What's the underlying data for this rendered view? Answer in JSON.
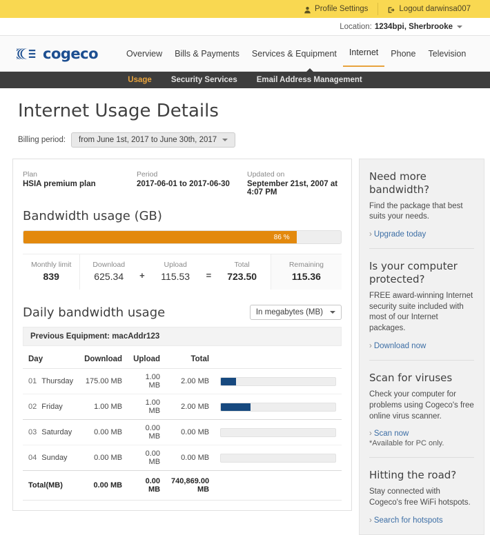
{
  "utilbar": {
    "profile_settings": "Profile Settings",
    "logout": "Logout darwinsa007"
  },
  "locationbar": {
    "label": "Location:",
    "value": "1234bpi, Sherbrooke"
  },
  "brand": {
    "name": "cogeco",
    "color": "#1d4f91"
  },
  "mainnav": {
    "items": [
      {
        "label": "Overview",
        "active": false
      },
      {
        "label": "Bills & Payments",
        "active": false
      },
      {
        "label": "Services & Equipment",
        "active": false
      },
      {
        "label": "Internet",
        "active": true
      },
      {
        "label": "Phone",
        "active": false
      },
      {
        "label": "Television",
        "active": false
      }
    ]
  },
  "subnav": {
    "items": [
      {
        "label": "Usage",
        "active": true
      },
      {
        "label": "Security Services",
        "active": false
      },
      {
        "label": "Email Address Management",
        "active": false
      }
    ]
  },
  "page": {
    "title": "Internet Usage Details",
    "billing_period_label": "Billing period:",
    "billing_period_value": "from June 1st, 2017 to June 30th, 2017"
  },
  "summary": {
    "plan_label": "Plan",
    "plan_value": "HSIA premium plan",
    "period_label": "Period",
    "period_value": "2017-06-01 to 2017-06-30",
    "updated_label": "Updated on",
    "updated_value": "September 21st, 2007 at 4:07 PM",
    "bandwidth_title": "Bandwidth usage (GB)",
    "progress_percent": 86,
    "progress_text": "86 %",
    "progress_color": "#e3890d",
    "stats": [
      {
        "label": "Monthly limit",
        "value": "839",
        "bold": true,
        "op": ""
      },
      {
        "label": "Download",
        "value": "625.34",
        "bold": false,
        "op": "+"
      },
      {
        "label": "Upload",
        "value": "115.53",
        "bold": false,
        "op": "="
      },
      {
        "label": "Total",
        "value": "723.50",
        "bold": true,
        "op": ""
      },
      {
        "label": "Remaining",
        "value": "115.36",
        "bold": true,
        "op": ""
      }
    ]
  },
  "daily": {
    "title": "Daily bandwidth usage",
    "unit_selected": "In megabytes (MB)",
    "equipment": "Previous Equipment: macAddr123",
    "columns": [
      "Day",
      "Download",
      "Upload",
      "Total"
    ],
    "rows": [
      {
        "num": "01",
        "day": "Thursday",
        "download": "175.00 MB",
        "upload": "1.00 MB",
        "total": "2.00 MB",
        "bar_percent": 13
      },
      {
        "num": "02",
        "day": "Friday",
        "download": "1.00 MB",
        "upload": "1.00 MB",
        "total": "2.00 MB",
        "bar_percent": 26
      },
      {
        "num": "03",
        "day": "Saturday",
        "download": "0.00 MB",
        "upload": "0.00 MB",
        "total": "0.00 MB",
        "bar_percent": 0
      },
      {
        "num": "04",
        "day": "Sunday",
        "download": "0.00 MB",
        "upload": "0.00 MB",
        "total": "0.00 MB",
        "bar_percent": 0
      }
    ],
    "total_row": {
      "label": "Total(MB)",
      "download": "0.00 MB",
      "upload": "0.00 MB",
      "total": "740,869.00 MB"
    },
    "bar_color": "#17497f"
  },
  "sidebar": {
    "promos": [
      {
        "title": "Need more bandwidth?",
        "body": "Find the package that best suits your needs.",
        "link": "Upgrade today",
        "note": ""
      },
      {
        "title": "Is your computer protected?",
        "body": "FREE award-winning Internet security suite included with most of our Internet packages.",
        "link": "Download now",
        "note": ""
      },
      {
        "title": "Scan for viruses",
        "body": "Check your computer for problems using Cogeco's free online virus scanner.",
        "link": "Scan now",
        "note": "*Available for PC only."
      },
      {
        "title": "Hitting the road?",
        "body": "Stay connected with Cogeco's free WiFi hotspots.",
        "link": "Search for hotspots",
        "note": ""
      }
    ]
  }
}
